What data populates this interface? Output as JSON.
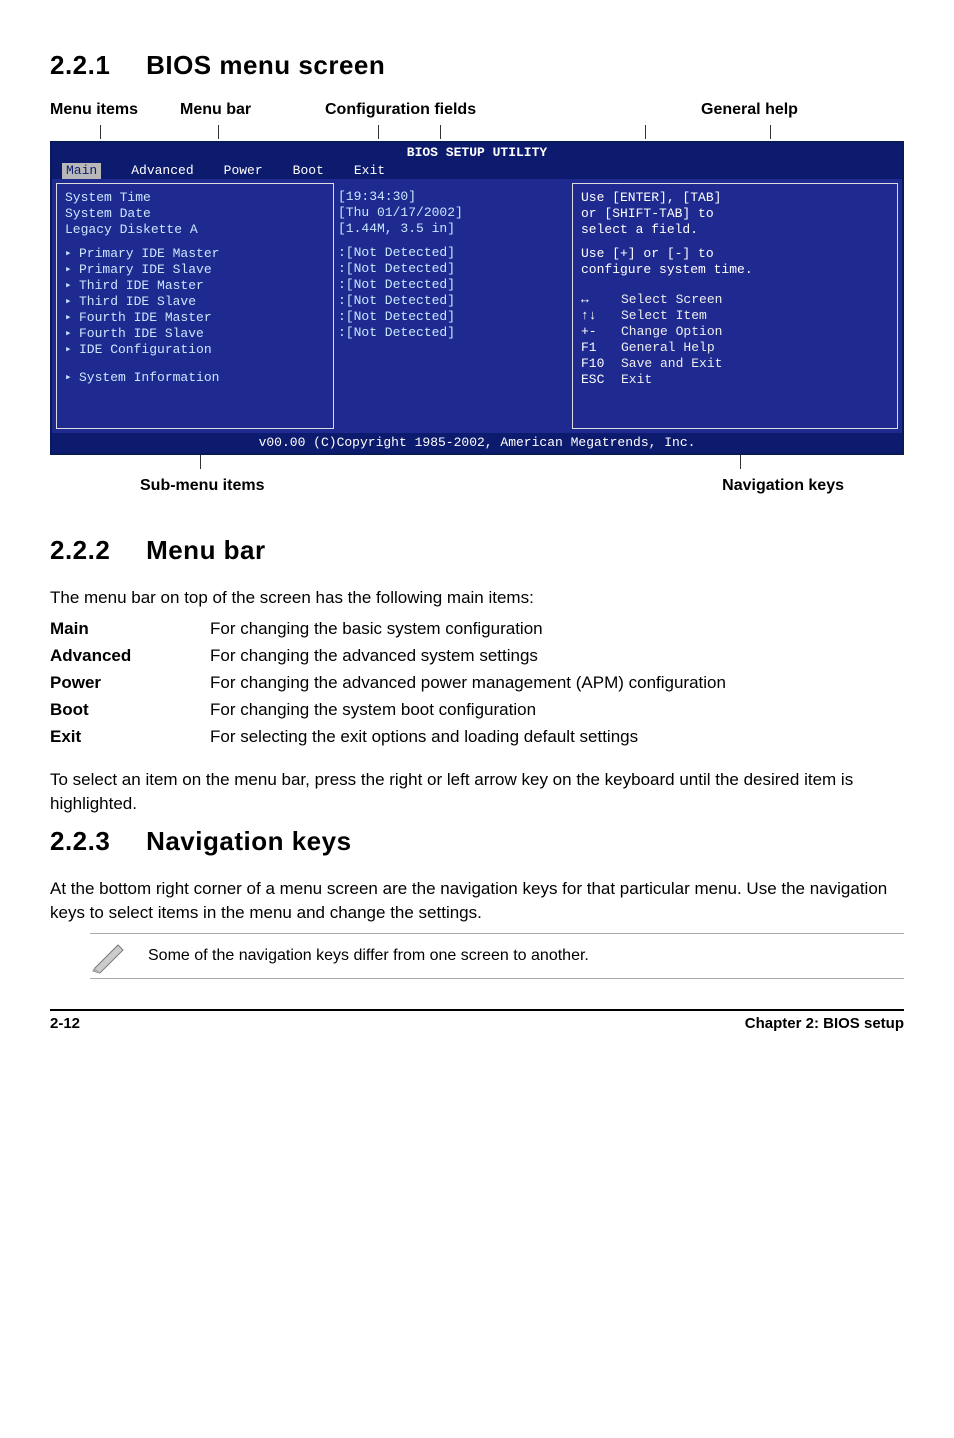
{
  "sections": {
    "s1": {
      "num": "2.2.1",
      "title": "BIOS menu screen"
    },
    "s2": {
      "num": "2.2.2",
      "title": "Menu bar"
    },
    "s3": {
      "num": "2.2.3",
      "title": "Navigation keys"
    }
  },
  "callouts": {
    "menu_items": "Menu items",
    "menu_bar": "Menu bar",
    "config_fields": "Configuration fields",
    "general_help": "General help",
    "submenu": "Sub-menu items",
    "navkeys": "Navigation keys"
  },
  "bios": {
    "header": "BIOS SETUP UTILITY",
    "tabs": {
      "main": "Main",
      "advanced": "Advanced",
      "power": "Power",
      "boot": "Boot",
      "exit": "Exit"
    },
    "left": {
      "l1": "System Time",
      "l2": "System Date",
      "l3": "Legacy Diskette A",
      "p1": "Primary IDE Master",
      "p2": "Primary IDE Slave",
      "p3": "Third IDE Master",
      "p4": "Third IDE Slave",
      "p5": "Fourth IDE Master",
      "p6": "Fourth IDE Slave",
      "p7": "IDE Configuration",
      "p8": "System Information"
    },
    "mid": {
      "v1": "[19:34:30]",
      "v2": "[Thu 01/17/2002]",
      "v3": "[1.44M, 3.5 in]",
      "d1": ":[Not Detected]",
      "d2": ":[Not Detected]",
      "d3": ":[Not Detected]",
      "d4": ":[Not Detected]",
      "d5": ":[Not Detected]",
      "d6": ":[Not Detected]"
    },
    "right": {
      "h1": "Use [ENTER], [TAB]",
      "h2": "or [SHIFT-TAB] to",
      "h3": "select a field.",
      "h4": "Use [+] or [-] to",
      "h5": "configure system time.",
      "n1k": "↔",
      "n1v": "Select Screen",
      "n2k": "↑↓",
      "n2v": "Select Item",
      "n3k": "+-",
      "n3v": "Change Option",
      "n4k": "F1",
      "n4v": "General Help",
      "n5k": "F10",
      "n5v": "Save and Exit",
      "n6k": "ESC",
      "n6v": "Exit"
    },
    "footer": "v00.00 (C)Copyright 1985-2002, American Megatrends, Inc."
  },
  "menubar_intro": "The menu bar on top of the screen has the following main items:",
  "menus": {
    "main": {
      "label": "Main",
      "desc": "For changing the basic system configuration"
    },
    "advanced": {
      "label": "Advanced",
      "desc": "For changing the advanced system settings"
    },
    "power": {
      "label": "Power",
      "desc": "For changing the advanced power management (APM) configuration"
    },
    "boot": {
      "label": "Boot",
      "desc": "For changing the system boot configuration"
    },
    "exit": {
      "label": "Exit",
      "desc": "For selecting the exit options and loading default settings"
    }
  },
  "menubar_note": "To select an item on the menu bar, press the right or left arrow key on the keyboard until the desired item is highlighted.",
  "navkeys_text": "At the bottom right corner of a menu screen are the navigation keys for that particular menu. Use the navigation keys to select items in the menu and change the settings.",
  "note": "Some of the navigation keys differ from one screen to another.",
  "footer": {
    "left": "2-12",
    "right": "Chapter 2: BIOS setup"
  }
}
